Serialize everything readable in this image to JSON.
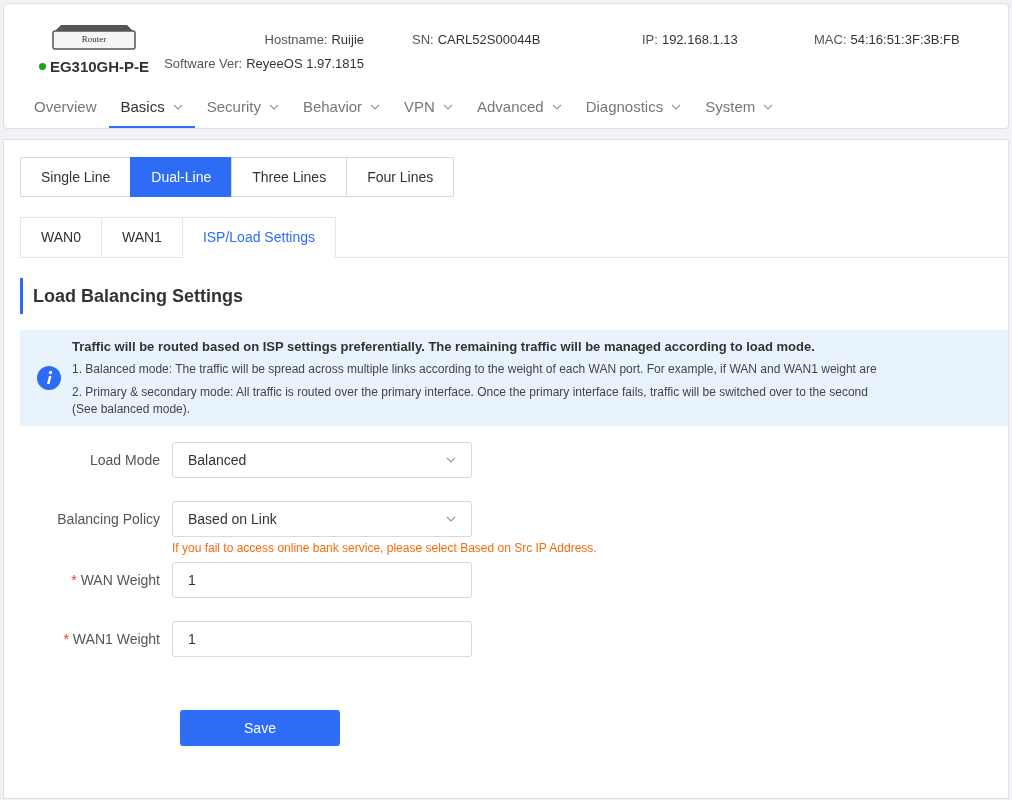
{
  "device": {
    "image_label": "Router",
    "model": "EG310GH-P-E",
    "online": true
  },
  "info": [
    {
      "label": "Hostname:",
      "value": "Ruijie"
    },
    {
      "label": "Software Ver:",
      "value": "ReyeeOS 1.97.1815"
    },
    {
      "label": "SN:",
      "value": "CARL52S00044B"
    },
    {
      "label": "IP:",
      "value": "192.168.1.13"
    },
    {
      "label": "MAC:",
      "value": "54:16:51:3F:3B:FB"
    }
  ],
  "nav": [
    {
      "label": "Overview",
      "selected": false,
      "dropdown": false
    },
    {
      "label": "Basics",
      "selected": true,
      "dropdown": true
    },
    {
      "label": "Security",
      "selected": false,
      "dropdown": true
    },
    {
      "label": "Behavior",
      "selected": false,
      "dropdown": true
    },
    {
      "label": "VPN",
      "selected": false,
      "dropdown": true
    },
    {
      "label": "Advanced",
      "selected": false,
      "dropdown": true
    },
    {
      "label": "Diagnostics",
      "selected": false,
      "dropdown": true
    },
    {
      "label": "System",
      "selected": false,
      "dropdown": true
    }
  ],
  "line_tabs": [
    {
      "label": "Single Line",
      "selected": false
    },
    {
      "label": "Dual-Line",
      "selected": true
    },
    {
      "label": "Three Lines",
      "selected": false
    },
    {
      "label": "Four Lines",
      "selected": false
    }
  ],
  "wan_tabs": [
    {
      "label": "WAN0",
      "selected": false
    },
    {
      "label": "WAN1",
      "selected": false
    },
    {
      "label": "ISP/Load Settings",
      "selected": true
    }
  ],
  "section_title": "Load Balancing Settings",
  "notice": {
    "heading": "Traffic will be routed based on ISP settings preferentially. The remaining traffic will be managed according to load mode.",
    "lines": [
      "1. Balanced mode: The traffic will be spread across multiple links according to the weight of each WAN port. For example, if WAN and WAN1 weight are",
      "2. Primary & secondary mode: All traffic is routed over the primary interface. Once the primary interface fails, traffic will be switched over to the second",
      "(See balanced mode)."
    ]
  },
  "fields": [
    {
      "kind": "select",
      "label": "Load Mode",
      "value": "Balanced"
    },
    {
      "kind": "select",
      "label": "Balancing Policy",
      "value": "Based on Link",
      "hint": "If you fail to access online bank service, please select Based on Src IP Address."
    },
    {
      "kind": "input",
      "required_mark": "*",
      "label": "WAN Weight",
      "value": "1"
    },
    {
      "kind": "input",
      "required_mark": "*",
      "label": "WAN1 Weight",
      "value": "1"
    }
  ],
  "save_button": "Save"
}
